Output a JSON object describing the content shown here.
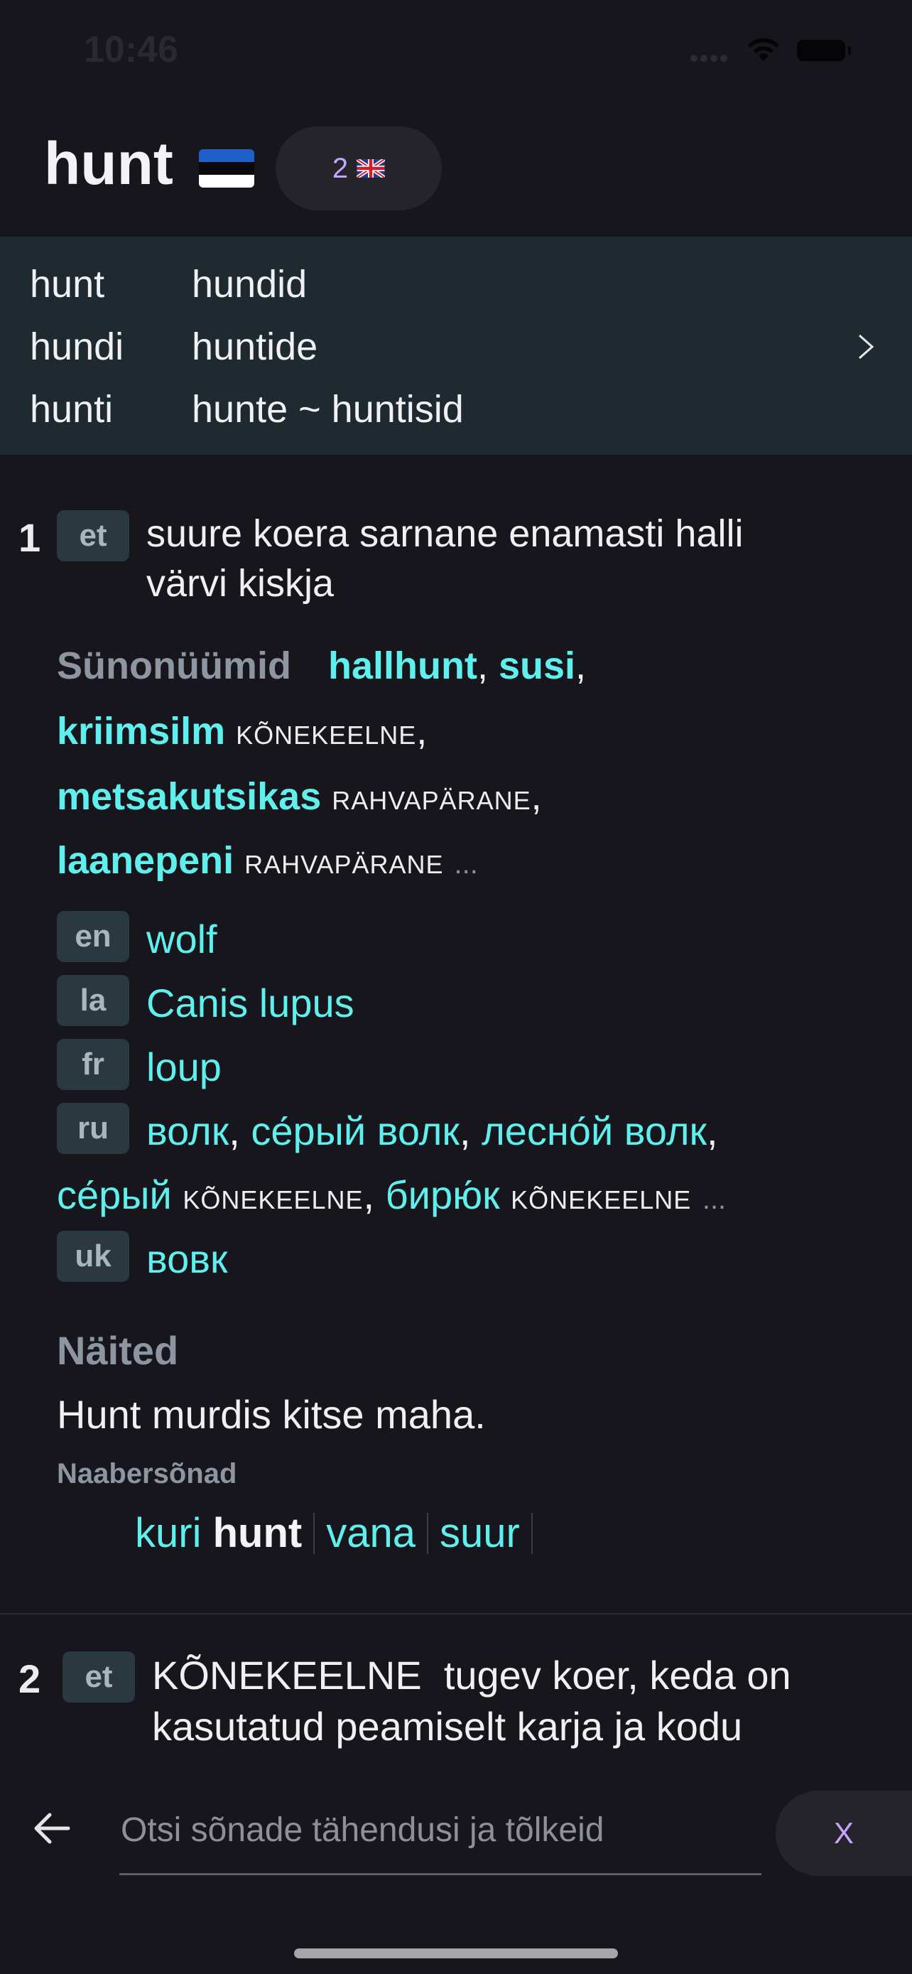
{
  "status_bar": {
    "time": "10:46"
  },
  "header": {
    "word": "hunt",
    "source_language_flag": "estonian-flag",
    "translation_count": "2",
    "target_language_flag": "uk-flag"
  },
  "forms": {
    "rows": [
      [
        "hunt",
        "hundid"
      ],
      [
        "hundi",
        "huntide"
      ],
      [
        "hunti",
        "hunte ~ huntisid"
      ]
    ]
  },
  "senses": [
    {
      "number": "1",
      "lang": "et",
      "definition_line1": "suure koera sarnane enamasti halli",
      "definition_line2": "värvi kiskja",
      "synonyms_heading": "Sünonüümid",
      "synonyms": [
        {
          "word": "hallhunt",
          "register": ""
        },
        {
          "word": "susi",
          "register": ""
        },
        {
          "word": "kriimsilm",
          "register": "KÕNEKEELNE"
        },
        {
          "word": "metsakutsikas",
          "register": "RAHVAPÄRANE"
        },
        {
          "word": "laanepeni",
          "register": "RAHVAPÄRANE"
        }
      ],
      "more": "...",
      "translations": {
        "en": {
          "lang": "en",
          "words": [
            "wolf"
          ]
        },
        "la": {
          "lang": "la",
          "words": [
            "Canis lupus"
          ]
        },
        "fr": {
          "lang": "fr",
          "words": [
            "loup"
          ]
        },
        "ru": {
          "lang": "ru",
          "words": [
            "волк",
            "се́рый волк",
            "лесно́й волк"
          ],
          "extra": [
            {
              "word": "се́рый",
              "register": "KÕNEKEELNE"
            },
            {
              "word": "бирю́к",
              "register": "KÕNEKEELNE"
            }
          ]
        },
        "uk": {
          "lang": "uk",
          "words": [
            "вовк"
          ]
        }
      },
      "examples_heading": "Näited",
      "example": "Hunt murdis kitse maha.",
      "neighbors_heading": "Naabersõnad",
      "neighbors": {
        "left": "kuri",
        "center": "hunt",
        "right1": "vana",
        "right2": "suur"
      }
    },
    {
      "number": "2",
      "lang": "et",
      "register": "KÕNEKEELNE",
      "definition_line1": "tugev koer, keda on",
      "definition_line2": "kasutatud peamiselt karja ja kodu"
    }
  ],
  "search": {
    "placeholder": "Otsi sõnade tähendusi ja tõlkeid",
    "clear_label": "X"
  },
  "colors": {
    "background": "#17161c",
    "forms_panel": "#1f2930",
    "accent_cyan": "#5ff0ee",
    "accent_purple": "#c7a5ff",
    "muted": "#8d96a0",
    "tag_bg": "#2a3940"
  }
}
